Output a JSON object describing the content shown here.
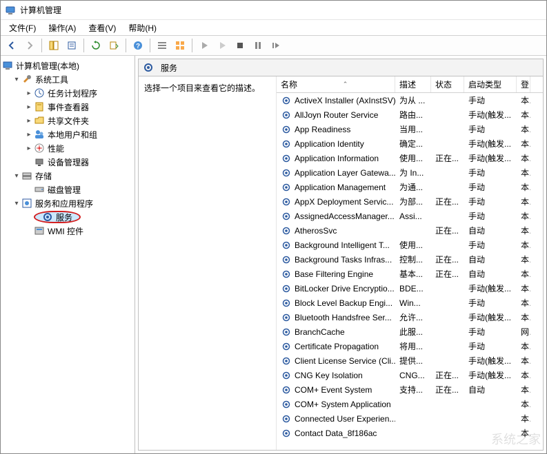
{
  "window": {
    "title": "计算机管理"
  },
  "menu": {
    "file": "文件(F)",
    "action": "操作(A)",
    "view": "查看(V)",
    "help": "帮助(H)"
  },
  "tree": {
    "root": "计算机管理(本地)",
    "system_tools": "系统工具",
    "task_scheduler": "任务计划程序",
    "event_viewer": "事件查看器",
    "shared_folders": "共享文件夹",
    "local_users": "本地用户和组",
    "performance": "性能",
    "device_manager": "设备管理器",
    "storage": "存储",
    "disk_mgmt": "磁盘管理",
    "services_apps": "服务和应用程序",
    "services": "服务",
    "wmi": "WMI 控件"
  },
  "panel": {
    "header": "服务",
    "desc_prompt": "选择一个项目来查看它的描述。"
  },
  "columns": {
    "name": "名称",
    "desc": "描述",
    "status": "状态",
    "startup": "启动类型",
    "logon": "登"
  },
  "services": [
    {
      "name": "ActiveX Installer (AxInstSV)",
      "desc": "为从 ...",
      "status": "",
      "startup": "手动",
      "logon": "本"
    },
    {
      "name": "AllJoyn Router Service",
      "desc": "路由...",
      "status": "",
      "startup": "手动(触发...",
      "logon": "本"
    },
    {
      "name": "App Readiness",
      "desc": "当用...",
      "status": "",
      "startup": "手动",
      "logon": "本"
    },
    {
      "name": "Application Identity",
      "desc": "确定...",
      "status": "",
      "startup": "手动(触发...",
      "logon": "本"
    },
    {
      "name": "Application Information",
      "desc": "使用...",
      "status": "正在...",
      "startup": "手动(触发...",
      "logon": "本"
    },
    {
      "name": "Application Layer Gatewa...",
      "desc": "为 In...",
      "status": "",
      "startup": "手动",
      "logon": "本"
    },
    {
      "name": "Application Management",
      "desc": "为通...",
      "status": "",
      "startup": "手动",
      "logon": "本"
    },
    {
      "name": "AppX Deployment Servic...",
      "desc": "为部...",
      "status": "正在...",
      "startup": "手动",
      "logon": "本"
    },
    {
      "name": "AssignedAccessManager...",
      "desc": "Assi...",
      "status": "",
      "startup": "手动",
      "logon": "本"
    },
    {
      "name": "AtherosSvc",
      "desc": "",
      "status": "正在...",
      "startup": "自动",
      "logon": "本"
    },
    {
      "name": "Background Intelligent T...",
      "desc": "使用...",
      "status": "",
      "startup": "手动",
      "logon": "本"
    },
    {
      "name": "Background Tasks Infras...",
      "desc": "控制...",
      "status": "正在...",
      "startup": "自动",
      "logon": "本"
    },
    {
      "name": "Base Filtering Engine",
      "desc": "基本...",
      "status": "正在...",
      "startup": "自动",
      "logon": "本"
    },
    {
      "name": "BitLocker Drive Encryptio...",
      "desc": "BDE...",
      "status": "",
      "startup": "手动(触发...",
      "logon": "本"
    },
    {
      "name": "Block Level Backup Engi...",
      "desc": "Win...",
      "status": "",
      "startup": "手动",
      "logon": "本"
    },
    {
      "name": "Bluetooth Handsfree Ser...",
      "desc": "允许...",
      "status": "",
      "startup": "手动(触发...",
      "logon": "本"
    },
    {
      "name": "BranchCache",
      "desc": "此服...",
      "status": "",
      "startup": "手动",
      "logon": "网"
    },
    {
      "name": "Certificate Propagation",
      "desc": "将用...",
      "status": "",
      "startup": "手动",
      "logon": "本"
    },
    {
      "name": "Client License Service (Cli...",
      "desc": "提供...",
      "status": "",
      "startup": "手动(触发...",
      "logon": "本"
    },
    {
      "name": "CNG Key Isolation",
      "desc": "CNG...",
      "status": "正在...",
      "startup": "手动(触发...",
      "logon": "本"
    },
    {
      "name": "COM+ Event System",
      "desc": "支持...",
      "status": "正在...",
      "startup": "自动",
      "logon": "本"
    },
    {
      "name": "COM+ System Application",
      "desc": "",
      "status": "",
      "startup": "",
      "logon": "本"
    },
    {
      "name": "Connected User Experien...",
      "desc": "",
      "status": "",
      "startup": "",
      "logon": "本"
    },
    {
      "name": "Contact Data_8f186ac",
      "desc": "",
      "status": "",
      "startup": "",
      "logon": "本"
    }
  ]
}
